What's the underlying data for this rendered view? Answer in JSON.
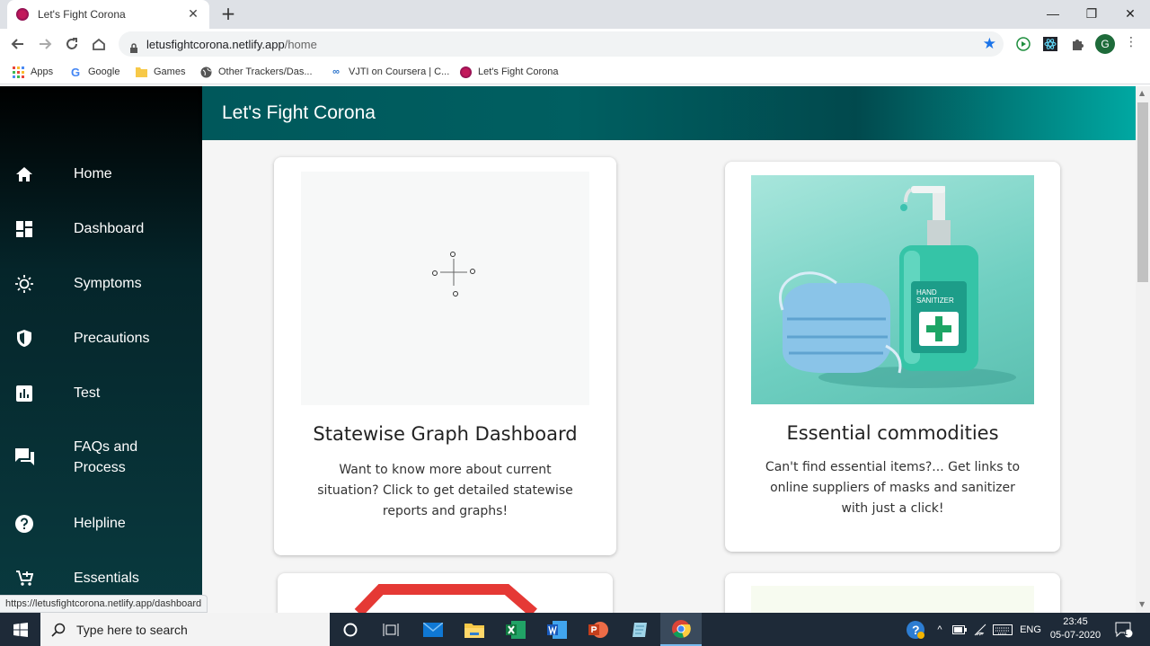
{
  "browser": {
    "tab_title": "Let's Fight Corona",
    "tab_close": "✕",
    "new_tab": "+",
    "url_host": "letusfightcorona.netlify.app",
    "url_path": "/home",
    "profile_initial": "G",
    "window_controls": {
      "minimize": "—",
      "restore": "❐",
      "close": "✕"
    },
    "bookmarks": [
      {
        "label": "Apps",
        "icon": "apps-grid-icon"
      },
      {
        "label": "Google",
        "icon": "google-icon"
      },
      {
        "label": "Games",
        "icon": "folder-icon"
      },
      {
        "label": "Other Trackers/Das...",
        "icon": "globe-icon"
      },
      {
        "label": "VJTI on Coursera | C...",
        "icon": "coursera-icon"
      },
      {
        "label": "Let's Fight Corona",
        "icon": "virus-icon"
      }
    ],
    "status_url": "https://letusfightcorona.netlify.app/dashboard"
  },
  "app": {
    "title": "Let's Fight Corona",
    "nav": [
      {
        "label": "Home",
        "icon": "home-icon"
      },
      {
        "label": "Dashboard",
        "icon": "dashboard-icon"
      },
      {
        "label": "Symptoms",
        "icon": "sun-icon"
      },
      {
        "label": "Precautions",
        "icon": "shield-icon"
      },
      {
        "label": "Test",
        "icon": "bar-chart-icon"
      },
      {
        "label": "FAQs and Process",
        "icon": "chat-icon"
      },
      {
        "label": "Helpline",
        "icon": "help-icon"
      },
      {
        "label": "Essentials",
        "icon": "cart-icon"
      }
    ],
    "cards": [
      {
        "title": "Statewise Graph Dashboard",
        "description": "Want to know more about current situation? Click to get detailed statewise reports and graphs!"
      },
      {
        "title": "Essential commodities",
        "description": "Can't find essential items?... Get links to online suppliers of masks and sanitizer with just a click!",
        "image_label_line1": "HAND",
        "image_label_line2": "SANITIZER"
      }
    ]
  },
  "taskbar": {
    "search_placeholder": "Type here to search",
    "language": "ENG",
    "time": "23:45",
    "date": "05-07-2020",
    "notification_count": "1"
  },
  "colors": {
    "header_teal": "#005f61",
    "sidebar_dark": "#05252a",
    "bookmark_star": "#1a73e8"
  }
}
